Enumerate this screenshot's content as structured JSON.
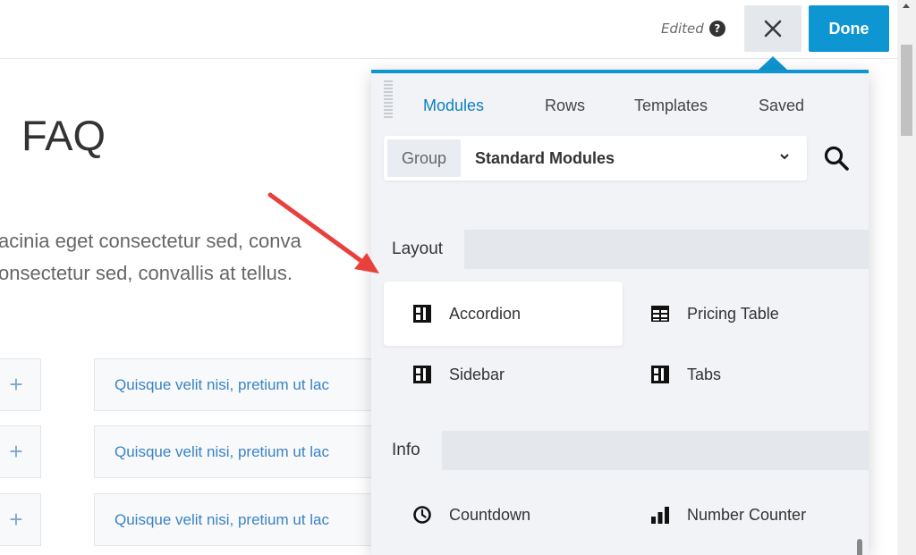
{
  "topbar": {
    "edited_label": "Edited",
    "help_glyph": "?",
    "close_glyph": "✕",
    "done_label": "Done"
  },
  "page": {
    "title": "FAQ",
    "paragraph_line1": "acinia eget consectetur sed, conva",
    "paragraph_line2": "onsectetur sed, convallis at tellus.",
    "faq_items": [
      {
        "toggle": "+",
        "question": "Quisque velit nisi, pretium ut lac"
      },
      {
        "toggle": "+",
        "question": "Quisque velit nisi, pretium ut lac"
      },
      {
        "toggle": "+",
        "question": "Quisque velit nisi, pretium ut lac"
      }
    ]
  },
  "panel": {
    "tabs": [
      "Modules",
      "Rows",
      "Templates",
      "Saved"
    ],
    "active_tab": "Modules",
    "group_label": "Group",
    "group_value": "Standard Modules",
    "sections": [
      {
        "title": "Layout",
        "modules": [
          "Accordion",
          "Pricing Table",
          "Sidebar",
          "Tabs"
        ]
      },
      {
        "title": "Info",
        "modules": [
          "Countdown",
          "Number Counter"
        ]
      }
    ],
    "highlighted_module": "Accordion"
  },
  "colors": {
    "accent": "#0e96d2",
    "arrow": "#e8413c"
  },
  "icons": [
    "help-icon",
    "close-icon",
    "chevron-down-icon",
    "search-icon",
    "accordion-icon",
    "table-icon",
    "sidebar-icon",
    "tabs-icon",
    "clock-icon",
    "bar-chart-icon"
  ]
}
